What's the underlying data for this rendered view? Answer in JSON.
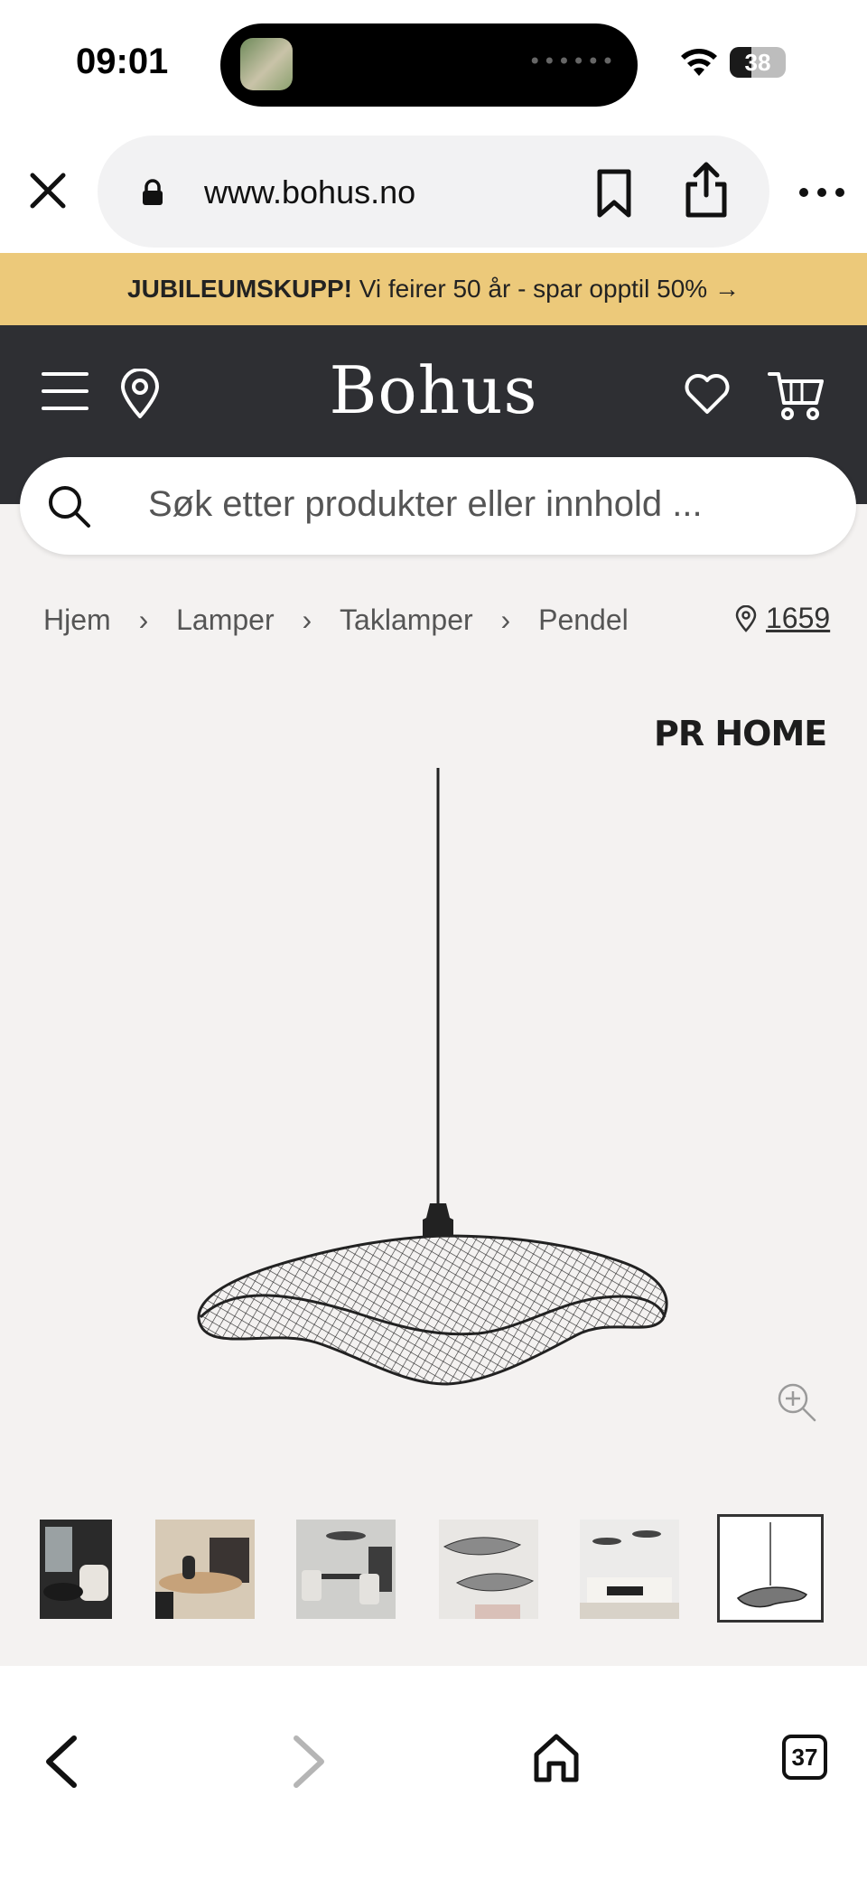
{
  "status_bar": {
    "time": "09:01",
    "battery": "38",
    "battery_level": 0.38,
    "island_dots": "••••••"
  },
  "browser": {
    "url": "www.bohus.no",
    "tab_count": "37"
  },
  "promo": {
    "highlight": "JUBILEUMSKUPP!",
    "text": " Vi feirer 50 år - spar opptil 50% →"
  },
  "header": {
    "logo": "Bohus"
  },
  "search": {
    "placeholder": "Søk etter produkter eller innhold ..."
  },
  "breadcrumb": {
    "items": [
      "Hjem",
      "Lamper",
      "Taklamper",
      "Pendel"
    ],
    "separator": "›"
  },
  "store": {
    "code": "1659"
  },
  "product": {
    "brand": "PR HOME"
  },
  "icons": {
    "close": "close-icon",
    "lock": "lock-icon",
    "bookmark": "bookmark-icon",
    "share": "share-icon",
    "more": "more-icon",
    "menu": "hamburger-icon",
    "location": "location-pin-icon",
    "wishlist": "heart-icon",
    "cart": "cart-icon",
    "search": "search-icon",
    "zoom": "zoom-in-icon",
    "back": "chevron-left-icon",
    "forward": "chevron-right-icon",
    "home": "home-icon"
  },
  "colors": {
    "promo_bg": "#ecc97a",
    "header_bg": "#2e2f33",
    "page_bg": "#f4f2f1"
  }
}
